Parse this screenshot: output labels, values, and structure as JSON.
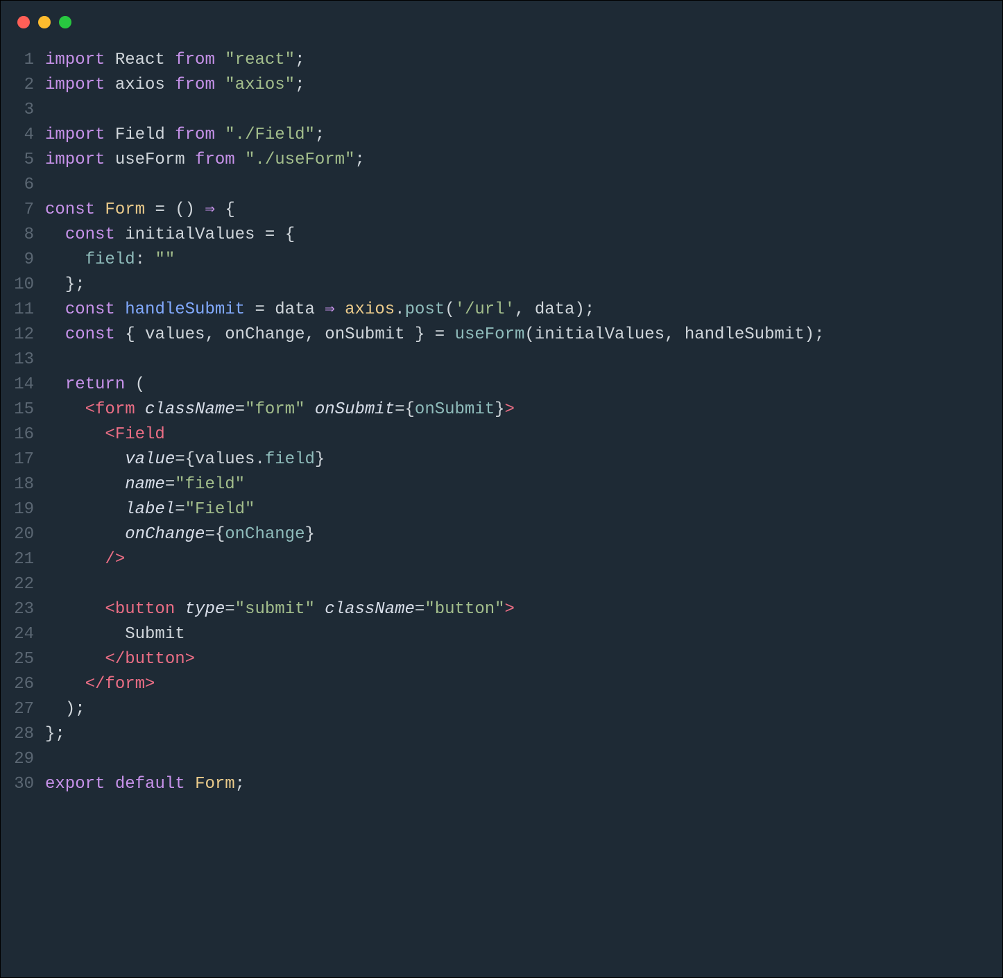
{
  "window": {
    "dots": [
      "close",
      "minimize",
      "maximize"
    ]
  },
  "code": {
    "lines": [
      {
        "n": 1,
        "tokens": [
          [
            "kw",
            "import"
          ],
          [
            "id",
            " React "
          ],
          [
            "kw",
            "from"
          ],
          [
            "id",
            " "
          ],
          [
            "str",
            "\"react\""
          ],
          [
            "pun",
            ";"
          ]
        ]
      },
      {
        "n": 2,
        "tokens": [
          [
            "kw",
            "import"
          ],
          [
            "id",
            " axios "
          ],
          [
            "kw",
            "from"
          ],
          [
            "id",
            " "
          ],
          [
            "str",
            "\"axios\""
          ],
          [
            "pun",
            ";"
          ]
        ]
      },
      {
        "n": 3,
        "tokens": []
      },
      {
        "n": 4,
        "tokens": [
          [
            "kw",
            "import"
          ],
          [
            "id",
            " Field "
          ],
          [
            "kw",
            "from"
          ],
          [
            "id",
            " "
          ],
          [
            "str",
            "\"./Field\""
          ],
          [
            "pun",
            ";"
          ]
        ]
      },
      {
        "n": 5,
        "tokens": [
          [
            "kw",
            "import"
          ],
          [
            "id",
            " useForm "
          ],
          [
            "kw",
            "from"
          ],
          [
            "id",
            " "
          ],
          [
            "str",
            "\"./useForm\""
          ],
          [
            "pun",
            ";"
          ]
        ]
      },
      {
        "n": 6,
        "tokens": []
      },
      {
        "n": 7,
        "tokens": [
          [
            "kw",
            "const"
          ],
          [
            "id",
            " "
          ],
          [
            "const",
            "Form"
          ],
          [
            "id",
            " "
          ],
          [
            "pun",
            "="
          ],
          [
            "id",
            " "
          ],
          [
            "pun",
            "()"
          ],
          [
            "id",
            " "
          ],
          [
            "op",
            "⇒"
          ],
          [
            "id",
            " "
          ],
          [
            "pun",
            "{"
          ]
        ]
      },
      {
        "n": 8,
        "tokens": [
          [
            "id",
            "  "
          ],
          [
            "kw",
            "const"
          ],
          [
            "id",
            " initialValues "
          ],
          [
            "pun",
            "="
          ],
          [
            "id",
            " "
          ],
          [
            "pun",
            "{"
          ]
        ]
      },
      {
        "n": 9,
        "tokens": [
          [
            "id",
            "    "
          ],
          [
            "prop",
            "field"
          ],
          [
            "pun",
            ":"
          ],
          [
            "id",
            " "
          ],
          [
            "str",
            "\"\""
          ]
        ]
      },
      {
        "n": 10,
        "tokens": [
          [
            "id",
            "  "
          ],
          [
            "pun",
            "};"
          ]
        ]
      },
      {
        "n": 11,
        "tokens": [
          [
            "id",
            "  "
          ],
          [
            "kw",
            "const"
          ],
          [
            "id",
            " "
          ],
          [
            "fn",
            "handleSubmit"
          ],
          [
            "id",
            " "
          ],
          [
            "pun",
            "="
          ],
          [
            "id",
            " data "
          ],
          [
            "op",
            "⇒"
          ],
          [
            "id",
            " "
          ],
          [
            "obj",
            "axios"
          ],
          [
            "pun",
            "."
          ],
          [
            "prop",
            "post"
          ],
          [
            "pun",
            "("
          ],
          [
            "str",
            "'/url'"
          ],
          [
            "pun",
            ", "
          ],
          [
            "id",
            "data"
          ],
          [
            "pun",
            ");"
          ]
        ]
      },
      {
        "n": 12,
        "tokens": [
          [
            "id",
            "  "
          ],
          [
            "kw",
            "const"
          ],
          [
            "id",
            " "
          ],
          [
            "pun",
            "{"
          ],
          [
            "id",
            " values"
          ],
          [
            "pun",
            ","
          ],
          [
            "id",
            " onChange"
          ],
          [
            "pun",
            ","
          ],
          [
            "id",
            " onSubmit "
          ],
          [
            "pun",
            "}"
          ],
          [
            "id",
            " "
          ],
          [
            "pun",
            "="
          ],
          [
            "id",
            " "
          ],
          [
            "prop",
            "useForm"
          ],
          [
            "pun",
            "("
          ],
          [
            "id",
            "initialValues"
          ],
          [
            "pun",
            ", "
          ],
          [
            "id",
            "handleSubmit"
          ],
          [
            "pun",
            ");"
          ]
        ]
      },
      {
        "n": 13,
        "tokens": []
      },
      {
        "n": 14,
        "tokens": [
          [
            "id",
            "  "
          ],
          [
            "kw",
            "return"
          ],
          [
            "id",
            " "
          ],
          [
            "pun",
            "("
          ]
        ]
      },
      {
        "n": 15,
        "tokens": [
          [
            "id",
            "    "
          ],
          [
            "tag",
            "<form"
          ],
          [
            "id",
            " "
          ],
          [
            "attr",
            "className"
          ],
          [
            "pun",
            "="
          ],
          [
            "str",
            "\"form\""
          ],
          [
            "id",
            " "
          ],
          [
            "attr",
            "onSubmit"
          ],
          [
            "pun",
            "="
          ],
          [
            "pun",
            "{"
          ],
          [
            "prop",
            "onSubmit"
          ],
          [
            "pun",
            "}"
          ],
          [
            "tag",
            ">"
          ]
        ]
      },
      {
        "n": 16,
        "tokens": [
          [
            "id",
            "      "
          ],
          [
            "tag",
            "<Field"
          ]
        ]
      },
      {
        "n": 17,
        "tokens": [
          [
            "id",
            "        "
          ],
          [
            "attr",
            "value"
          ],
          [
            "pun",
            "="
          ],
          [
            "pun",
            "{"
          ],
          [
            "id",
            "values"
          ],
          [
            "pun",
            "."
          ],
          [
            "prop",
            "field"
          ],
          [
            "pun",
            "}"
          ]
        ]
      },
      {
        "n": 18,
        "tokens": [
          [
            "id",
            "        "
          ],
          [
            "attr",
            "name"
          ],
          [
            "pun",
            "="
          ],
          [
            "str",
            "\"field\""
          ]
        ]
      },
      {
        "n": 19,
        "tokens": [
          [
            "id",
            "        "
          ],
          [
            "attr",
            "label"
          ],
          [
            "pun",
            "="
          ],
          [
            "str",
            "\"Field\""
          ]
        ]
      },
      {
        "n": 20,
        "tokens": [
          [
            "id",
            "        "
          ],
          [
            "attr",
            "onChange"
          ],
          [
            "pun",
            "="
          ],
          [
            "pun",
            "{"
          ],
          [
            "prop",
            "onChange"
          ],
          [
            "pun",
            "}"
          ]
        ]
      },
      {
        "n": 21,
        "tokens": [
          [
            "id",
            "      "
          ],
          [
            "tag",
            "/>"
          ]
        ]
      },
      {
        "n": 22,
        "tokens": []
      },
      {
        "n": 23,
        "tokens": [
          [
            "id",
            "      "
          ],
          [
            "tag",
            "<button"
          ],
          [
            "id",
            " "
          ],
          [
            "attr",
            "type"
          ],
          [
            "pun",
            "="
          ],
          [
            "str",
            "\"submit\""
          ],
          [
            "id",
            " "
          ],
          [
            "attr",
            "className"
          ],
          [
            "pun",
            "="
          ],
          [
            "str",
            "\"button\""
          ],
          [
            "tag",
            ">"
          ]
        ]
      },
      {
        "n": 24,
        "tokens": [
          [
            "id",
            "        Submit"
          ]
        ]
      },
      {
        "n": 25,
        "tokens": [
          [
            "id",
            "      "
          ],
          [
            "tag",
            "</button>"
          ]
        ]
      },
      {
        "n": 26,
        "tokens": [
          [
            "id",
            "    "
          ],
          [
            "tag",
            "</form>"
          ]
        ]
      },
      {
        "n": 27,
        "tokens": [
          [
            "id",
            "  "
          ],
          [
            "pun",
            ");"
          ]
        ]
      },
      {
        "n": 28,
        "tokens": [
          [
            "pun",
            "};"
          ]
        ]
      },
      {
        "n": 29,
        "tokens": []
      },
      {
        "n": 30,
        "tokens": [
          [
            "kw",
            "export"
          ],
          [
            "id",
            " "
          ],
          [
            "kw",
            "default"
          ],
          [
            "id",
            " "
          ],
          [
            "const",
            "Form"
          ],
          [
            "pun",
            ";"
          ]
        ]
      }
    ]
  }
}
